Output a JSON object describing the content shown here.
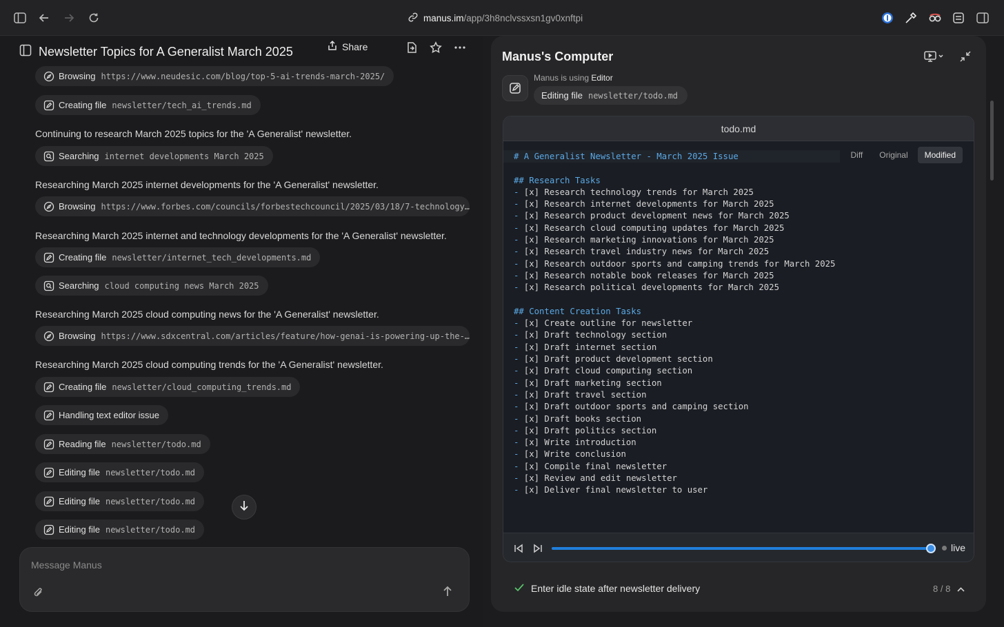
{
  "browser": {
    "url_host": "manus.im",
    "url_path": "/app/3h8nclvssxsn1gv0xnftpi",
    "icons": [
      "sidebar-toggle-icon",
      "back-arrow-icon",
      "forward-arrow-icon",
      "reload-icon",
      "link-icon",
      "password-manager-icon",
      "eyedropper-icon",
      "extension-glasses-icon",
      "extension-panel-icon",
      "sidebar-right-icon"
    ]
  },
  "chat": {
    "title": "Newsletter Topics for A Generalist March 2025",
    "share_label": "Share",
    "feed": [
      {
        "kind": "pill",
        "icon": "globe-icon",
        "label": "Browsing",
        "arg": "https://www.neudesic.com/blog/top-5-ai-trends-march-2025/"
      },
      {
        "kind": "pill",
        "icon": "edit-icon",
        "label": "Creating file",
        "arg": "newsletter/tech_ai_trends.md"
      },
      {
        "kind": "msg",
        "text": "Continuing to research March 2025 topics for the 'A Generalist' newsletter."
      },
      {
        "kind": "pill",
        "icon": "search-icon",
        "label": "Searching",
        "arg": "internet developments March 2025"
      },
      {
        "kind": "msg",
        "text": "Researching March 2025 internet developments for the 'A Generalist' newsletter."
      },
      {
        "kind": "pill",
        "icon": "globe-icon",
        "label": "Browsing",
        "arg": "https://www.forbes.com/councils/forbestechcouncil/2025/03/18/7-technology…"
      },
      {
        "kind": "msg",
        "text": "Researching March 2025 internet and technology developments for the 'A Generalist' newsletter."
      },
      {
        "kind": "pill",
        "icon": "edit-icon",
        "label": "Creating file",
        "arg": "newsletter/internet_tech_developments.md"
      },
      {
        "kind": "pill",
        "icon": "search-icon",
        "label": "Searching",
        "arg": "cloud computing news March 2025"
      },
      {
        "kind": "msg",
        "text": "Researching March 2025 cloud computing news for the 'A Generalist' newsletter."
      },
      {
        "kind": "pill",
        "icon": "globe-icon",
        "label": "Browsing",
        "arg": "https://www.sdxcentral.com/articles/feature/how-genai-is-powering-up-the-…"
      },
      {
        "kind": "msg",
        "text": "Researching March 2025 cloud computing trends for the 'A Generalist' newsletter."
      },
      {
        "kind": "pill",
        "icon": "edit-icon",
        "label": "Creating file",
        "arg": "newsletter/cloud_computing_trends.md"
      },
      {
        "kind": "pill",
        "icon": "edit-icon",
        "label": "Handling text editor issue",
        "arg": ""
      },
      {
        "kind": "pill",
        "icon": "edit-icon",
        "label": "Reading file",
        "arg": "newsletter/todo.md"
      },
      {
        "kind": "pill",
        "icon": "edit-icon",
        "label": "Editing file",
        "arg": "newsletter/todo.md"
      },
      {
        "kind": "pill",
        "icon": "edit-icon",
        "label": "Editing file",
        "arg": "newsletter/todo.md"
      },
      {
        "kind": "pill",
        "icon": "edit-icon",
        "label": "Editing file",
        "arg": "newsletter/todo.md"
      }
    ],
    "composer_placeholder": "Message Manus"
  },
  "computer": {
    "title": "Manus's Computer",
    "agent_prefix": "Manus is using ",
    "agent_tool": "Editor",
    "action_label": "Editing file",
    "action_arg": "newsletter/todo.md",
    "file_name": "todo.md",
    "view_tabs": [
      "Diff",
      "Original",
      "Modified"
    ],
    "active_tab": "Modified",
    "doc_title": "# A Generalist Newsletter - March 2025 Issue",
    "sections": [
      {
        "heading": "## Research Tasks",
        "items": [
          "[x] Research technology trends for March 2025",
          "[x] Research internet developments for March 2025",
          "[x] Research product development news for March 2025",
          "[x] Research cloud computing updates for March 2025",
          "[x] Research marketing innovations for March 2025",
          "[x] Research travel industry news for March 2025",
          "[x] Research outdoor sports and camping trends for March 2025",
          "[x] Research notable book releases for March 2025",
          "[x] Research political developments for March 2025"
        ]
      },
      {
        "heading": "## Content Creation Tasks",
        "items": [
          "[x] Create outline for newsletter",
          "[x] Draft technology section",
          "[x] Draft internet section",
          "[x] Draft product development section",
          "[x] Draft cloud computing section",
          "[x] Draft marketing section",
          "[x] Draft travel section",
          "[x] Draft outdoor sports and camping section",
          "[x] Draft books section",
          "[x] Draft politics section",
          "[x] Write introduction",
          "[x] Write conclusion",
          "[x] Compile final newsletter",
          "[x] Review and edit newsletter",
          "[x] Deliver final newsletter to user"
        ]
      }
    ],
    "playback_progress": 1.0,
    "live_label": "live",
    "current_task": "Enter idle state after newsletter delivery",
    "task_counter": "8 / 8"
  },
  "colors": {
    "accent": "#1f7fdb",
    "heading": "#5aa9e6",
    "success": "#58c26a"
  }
}
